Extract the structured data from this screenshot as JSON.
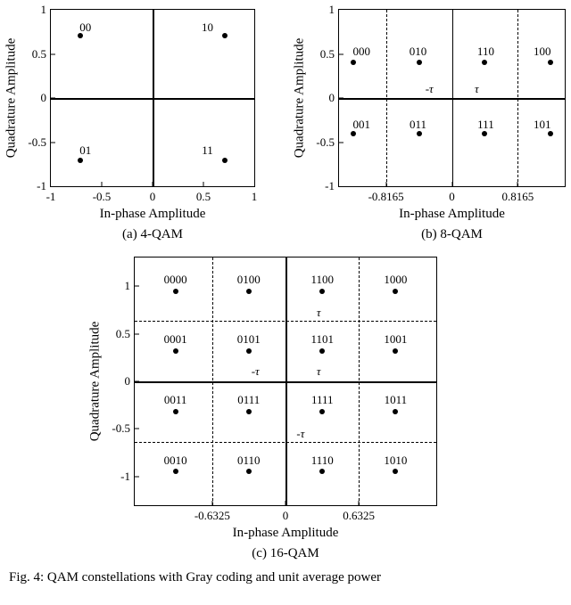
{
  "figure_caption": "Fig. 4: QAM constellations with Gray coding and unit average power",
  "axes": {
    "x": "In-phase Amplitude",
    "y": "Quadrature Amplitude"
  },
  "qam4": {
    "caption": "(a) 4-QAM",
    "xticks": {
      "n1": "-1",
      "n05": "-0.5",
      "z": "0",
      "p05": "0.5",
      "p1": "1"
    },
    "yticks": {
      "n1": "-1",
      "n05": "-0.5",
      "z": "0",
      "p05": "0.5",
      "p1": "1"
    },
    "labels": {
      "tl": "00",
      "tr": "10",
      "bl": "01",
      "br": "11"
    }
  },
  "qam8": {
    "caption": "(b) 8-QAM",
    "xticks": {
      "n": "-0.8165",
      "z": "0",
      "p": "0.8165"
    },
    "yticks": {
      "n1": "-1",
      "n05": "-0.5",
      "z": "0",
      "p05": "0.5",
      "p1": "1"
    },
    "labels": {
      "t0": "000",
      "t1": "010",
      "t2": "110",
      "t3": "100",
      "b0": "001",
      "b1": "011",
      "b2": "111",
      "b3": "101"
    },
    "tau_neg": "-τ",
    "tau_pos": "τ"
  },
  "qam16": {
    "caption": "(c) 16-QAM",
    "xticks": {
      "n": "-0.6325",
      "z": "0",
      "p": "0.6325"
    },
    "yticks": {
      "n1": "-1",
      "n05": "-0.5",
      "z": "0",
      "p05": "0.5",
      "p1": "1"
    },
    "labels": {
      "r0c0": "0000",
      "r0c1": "0100",
      "r0c2": "1100",
      "r0c3": "1000",
      "r1c0": "0001",
      "r1c1": "0101",
      "r1c2": "1101",
      "r1c3": "1001",
      "r2c0": "0011",
      "r2c1": "0111",
      "r2c2": "1111",
      "r2c3": "1011",
      "r3c0": "0010",
      "r3c1": "0110",
      "r3c2": "1110",
      "r3c3": "1010"
    },
    "tau_neg": "-τ",
    "tau_pos": "τ"
  },
  "chart_data": [
    {
      "type": "scatter",
      "title": "4-QAM",
      "xlabel": "In-phase Amplitude",
      "ylabel": "Quadrature Amplitude",
      "xlim": [
        -1,
        1
      ],
      "ylim": [
        -1,
        1
      ],
      "points": [
        {
          "x": -0.7071,
          "y": 0.7071,
          "code": "00"
        },
        {
          "x": 0.7071,
          "y": 0.7071,
          "code": "10"
        },
        {
          "x": -0.7071,
          "y": -0.7071,
          "code": "01"
        },
        {
          "x": 0.7071,
          "y": -0.7071,
          "code": "11"
        }
      ]
    },
    {
      "type": "scatter",
      "title": "8-QAM",
      "xlabel": "In-phase Amplitude",
      "ylabel": "Quadrature Amplitude",
      "xlim": [
        -1.4,
        1.4
      ],
      "ylim": [
        -1,
        1
      ],
      "xticks": [
        -0.8165,
        0,
        0.8165
      ],
      "decision_x": [
        -0.8165,
        0,
        0.8165
      ],
      "tau": 0.4082,
      "points": [
        {
          "x": -1.2247,
          "y": 0.4082,
          "code": "000"
        },
        {
          "x": -0.4082,
          "y": 0.4082,
          "code": "010"
        },
        {
          "x": 0.4082,
          "y": 0.4082,
          "code": "110"
        },
        {
          "x": 1.2247,
          "y": 0.4082,
          "code": "100"
        },
        {
          "x": -1.2247,
          "y": -0.4082,
          "code": "001"
        },
        {
          "x": -0.4082,
          "y": -0.4082,
          "code": "011"
        },
        {
          "x": 0.4082,
          "y": -0.4082,
          "code": "111"
        },
        {
          "x": 1.2247,
          "y": -0.4082,
          "code": "101"
        }
      ]
    },
    {
      "type": "scatter",
      "title": "16-QAM",
      "xlabel": "In-phase Amplitude",
      "ylabel": "Quadrature Amplitude",
      "xlim": [
        -1.3,
        1.3
      ],
      "ylim": [
        -1.3,
        1.3
      ],
      "xticks": [
        -0.6325,
        0,
        0.6325
      ],
      "decision_x": [
        -0.6325,
        0,
        0.6325
      ],
      "decision_y": [
        -0.6325,
        0,
        0.6325
      ],
      "tau": 0.3162,
      "points": [
        {
          "x": -0.9487,
          "y": 0.9487,
          "code": "0000"
        },
        {
          "x": -0.3162,
          "y": 0.9487,
          "code": "0100"
        },
        {
          "x": 0.3162,
          "y": 0.9487,
          "code": "1100"
        },
        {
          "x": 0.9487,
          "y": 0.9487,
          "code": "1000"
        },
        {
          "x": -0.9487,
          "y": 0.3162,
          "code": "0001"
        },
        {
          "x": -0.3162,
          "y": 0.3162,
          "code": "0101"
        },
        {
          "x": 0.3162,
          "y": 0.3162,
          "code": "1101"
        },
        {
          "x": 0.9487,
          "y": 0.3162,
          "code": "1001"
        },
        {
          "x": -0.9487,
          "y": -0.3162,
          "code": "0011"
        },
        {
          "x": -0.3162,
          "y": -0.3162,
          "code": "0111"
        },
        {
          "x": 0.3162,
          "y": -0.3162,
          "code": "1111"
        },
        {
          "x": 0.9487,
          "y": -0.3162,
          "code": "1011"
        },
        {
          "x": -0.9487,
          "y": -0.9487,
          "code": "0010"
        },
        {
          "x": -0.3162,
          "y": -0.9487,
          "code": "0110"
        },
        {
          "x": 0.3162,
          "y": -0.9487,
          "code": "1110"
        },
        {
          "x": 0.9487,
          "y": -0.9487,
          "code": "1010"
        }
      ]
    }
  ]
}
